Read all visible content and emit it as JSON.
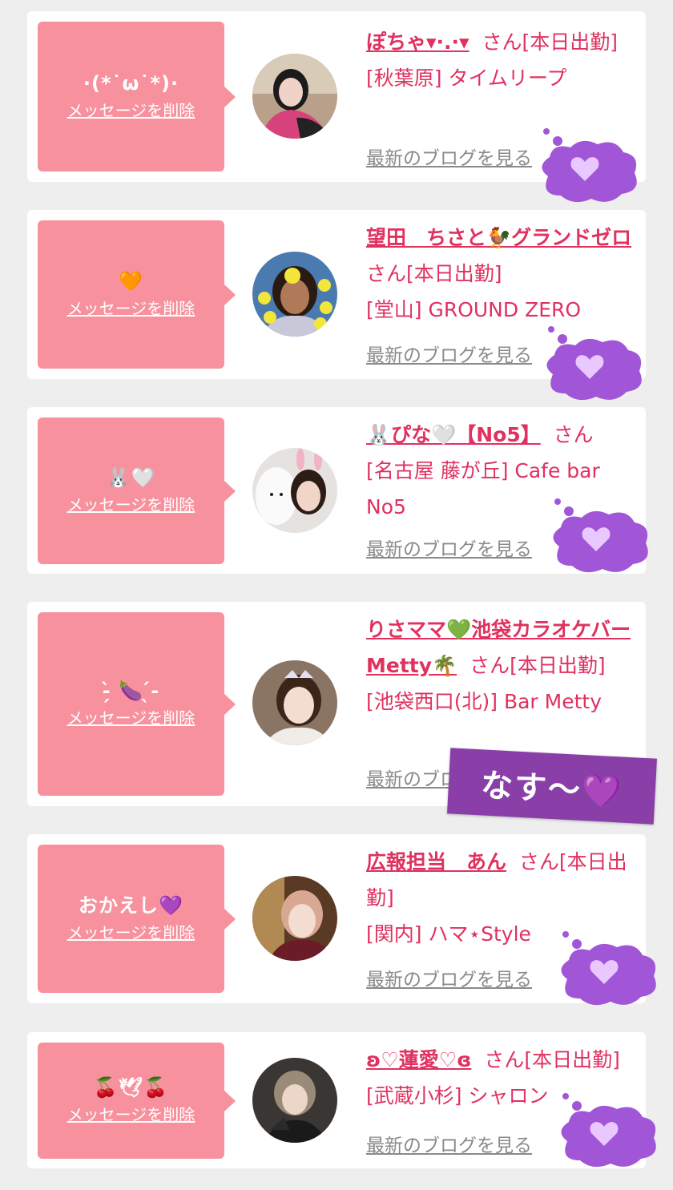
{
  "colors": {
    "page_bg": "#eeeeee",
    "card_bg": "#ffffff",
    "bubble_bg": "#f7919d",
    "name_accent": "#e0315f",
    "link_gray": "#8a8a8a",
    "cloud_purple": "#a156d8"
  },
  "delete_label": "メッセージを削除",
  "blog_label": "最新のブログを見る",
  "cards": [
    {
      "message": "·(*˙ω˙*)·",
      "name": "ぽちゃ▾·.·▾",
      "suffix": "さん[本日出勤]",
      "shop": "[秋葉原] タイムリープ",
      "avatar_icon": "profile-photo-icon"
    },
    {
      "message": "🧡",
      "name": "望田　ちさと🐓グランドゼロ",
      "suffix": "さん[本日出勤]",
      "shop": "[堂山] GROUND ZERO",
      "avatar_icon": "profile-photo-icon"
    },
    {
      "message": "🐰🤍",
      "name": "🐰ぴな🤍【No5】",
      "suffix": "さん",
      "shop": "[名古屋 藤が丘] Cafe bar No5",
      "avatar_icon": "profile-photo-icon"
    },
    {
      "message": "-̗̀ 🍆 ̖́-",
      "name": "りさママ💚池袋カラオケバーMetty🌴",
      "suffix": "さん[本日出勤]",
      "shop": "[池袋西口(北)] Bar Metty",
      "avatar_icon": "profile-photo-icon"
    },
    {
      "message": "おかえし💜",
      "name": "広報担当　あん",
      "suffix": "さん[本日出勤]",
      "shop": "[関内] ハマ⋆Style",
      "avatar_icon": "profile-photo-icon"
    },
    {
      "message": "🍒🕊🍒",
      "name": "ʚ♡蓮愛♡ɞ",
      "suffix": "さん[本日出勤]",
      "shop": "[武蔵小杉] シャロン",
      "avatar_icon": "profile-photo-icon"
    }
  ],
  "sticker_text": "なす〜💜",
  "cloud_icon": "heart-thought-cloud-icon"
}
